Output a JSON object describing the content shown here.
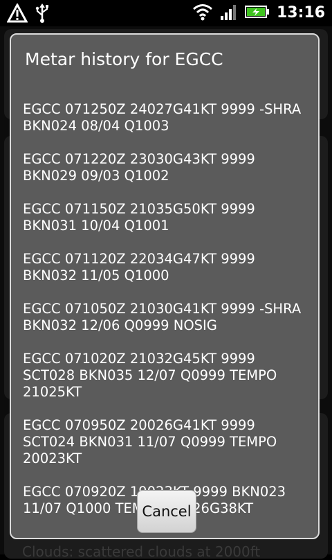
{
  "statusbar": {
    "time": "13:16",
    "icons": [
      "warning-icon",
      "usb-icon",
      "wifi-icon",
      "signal-icon",
      "battery-charging-icon"
    ]
  },
  "background": {
    "partial_text": "Clouds: scattered clouds at 2000ft"
  },
  "dialog": {
    "title": "Metar history for EGCC",
    "items": [
      "EGCC 071250Z 24027G41KT 9999 -SHRA BKN024 08/04 Q1003",
      "EGCC 071220Z 23030G43KT 9999 BKN029 09/03 Q1002",
      "EGCC 071150Z 21035G50KT 9999 BKN031 10/04 Q1001",
      "EGCC 071120Z 22034G47KT 9999 BKN032 11/05 Q1000",
      "EGCC 071050Z 21030G41KT 9999 -SHRA BKN032 12/06 Q0999 NOSIG",
      "EGCC 071020Z 21032G45KT 9999 SCT028 BKN035 12/07 Q0999 TEMPO 21025KT",
      "EGCC 070950Z 20026G41KT 9999 SCT024 BKN031 11/07 Q0999 TEMPO 20023KT",
      "EGCC 070920Z 19023KT 9999 BKN023 11/07 Q1000 TEMPO 19026G38KT"
    ],
    "cancel_label": "Cancel"
  }
}
